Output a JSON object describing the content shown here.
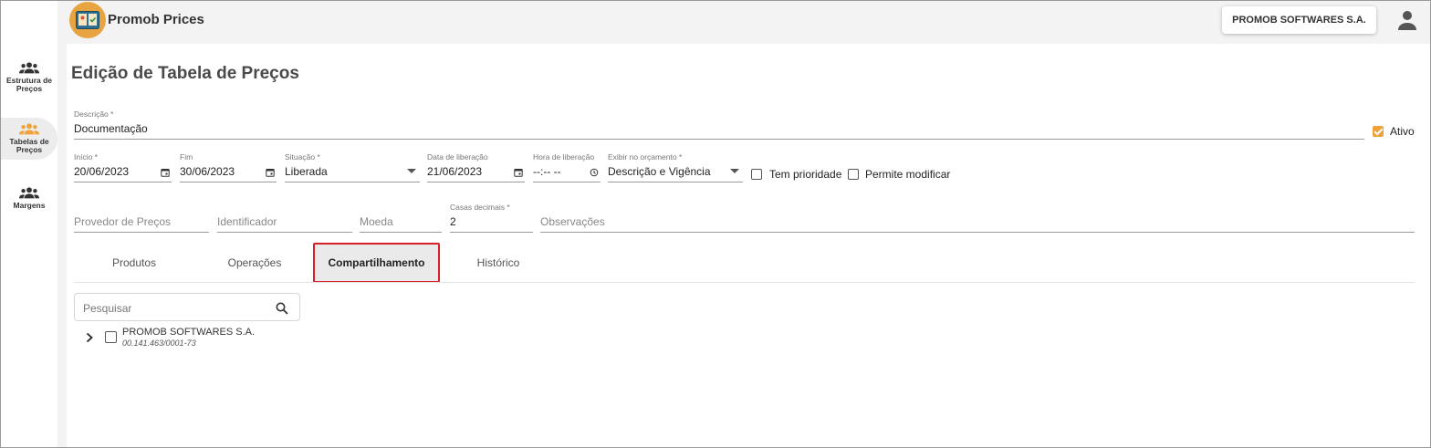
{
  "app": {
    "title": "Promob Prices",
    "logo_icon": "price-list-logo-icon",
    "accent_color": "#f0a23a"
  },
  "header": {
    "company_button": "PROMOB SOFTWARES S.A.",
    "user_icon": "account-icon"
  },
  "sidebar": {
    "items": [
      {
        "label_line1": "Estrutura de",
        "label_line2": "Preços",
        "icon": "group-icon",
        "active": false
      },
      {
        "label_line1": "Tabelas de",
        "label_line2": "Preços",
        "icon": "group-icon",
        "active": true
      },
      {
        "label_line1": "Margens",
        "label_line2": "",
        "icon": "group-icon",
        "active": false
      }
    ]
  },
  "page": {
    "title": "Edição de Tabela de Preços"
  },
  "form": {
    "descricao": {
      "label": "Descrição *",
      "value": "Documentação"
    },
    "ativo": {
      "label": "Ativo",
      "checked": true
    },
    "inicio": {
      "label": "Início *",
      "value": "20/06/2023"
    },
    "fim": {
      "label": "Fim",
      "value": "30/06/2023"
    },
    "situacao": {
      "label": "Situação *",
      "value": "Liberada"
    },
    "data_liberacao": {
      "label": "Data de liberação",
      "value": "21/06/2023"
    },
    "hora_liberacao": {
      "label": "Hora de liberação",
      "value": "--:-- --"
    },
    "exibir_orcamento": {
      "label": "Exibir no orçamento *",
      "value": "Descrição e Vigência"
    },
    "tem_prioridade": {
      "label": "Tem prioridade",
      "checked": false
    },
    "permite_modificar": {
      "label": "Permite modificar",
      "checked": false
    },
    "provedor_precos": {
      "placeholder": "Provedor de Preços"
    },
    "identificador": {
      "placeholder": "Identificador"
    },
    "moeda": {
      "placeholder": "Moeda"
    },
    "casas_decimais": {
      "label": "Casas decimais *",
      "value": "2"
    },
    "observacoes": {
      "placeholder": "Observações"
    }
  },
  "tabs": [
    {
      "label": "Produtos",
      "active": false
    },
    {
      "label": "Operações",
      "active": false
    },
    {
      "label": "Compartilhamento",
      "active": true
    },
    {
      "label": "Histórico",
      "active": false
    }
  ],
  "search": {
    "placeholder": "Pesquisar"
  },
  "tree": [
    {
      "name": "PROMOB SOFTWARES S.A.",
      "cnpj": "00.141.463/0001-73",
      "checked": false,
      "expanded": false
    }
  ]
}
